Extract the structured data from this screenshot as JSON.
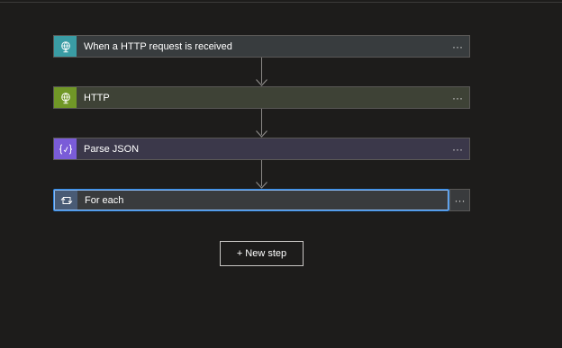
{
  "flow": {
    "steps": [
      {
        "label": "When a HTTP request is received",
        "icon": "globe-request-icon",
        "more": "···"
      },
      {
        "label": "HTTP",
        "icon": "globe-icon",
        "more": "···"
      },
      {
        "label": "Parse JSON",
        "icon": "json-braces-icon",
        "more": "···"
      },
      {
        "label": "For each",
        "icon": "loop-icon",
        "more": "···"
      }
    ],
    "new_step_label": "+ New step"
  },
  "colors": {
    "background": "#1d1c1b",
    "request_trigger": "#3a9ca4",
    "http": "#709727",
    "parse_json": "#7a5cd8",
    "for_each": "#495b75",
    "selected_border": "#2f88e6"
  }
}
